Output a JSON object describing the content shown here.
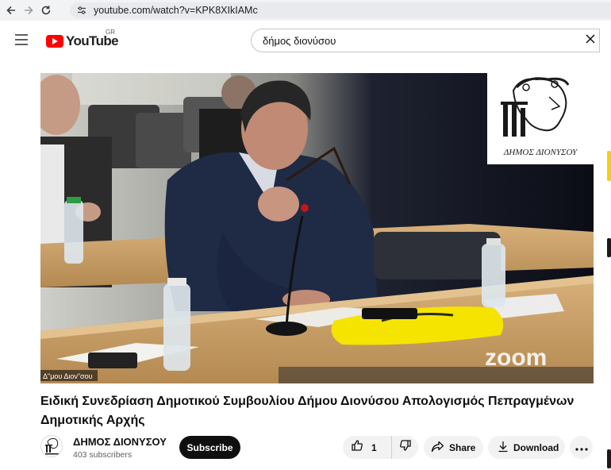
{
  "browser": {
    "url": "youtube.com/watch?v=KPK8XIkIAMc"
  },
  "header": {
    "logo_text": "YouTube",
    "country": "GR",
    "search_query": "δήμος διονύσου"
  },
  "video": {
    "logo_caption": "ΔΗΜΟΣ ΔΙΟΝΥΣΟΥ",
    "zoom_watermark": "zoom",
    "overlay_label": "Δ\"μου Διον\"σου"
  },
  "title": "Ειδική Συνεδρίαση Δημοτικού Συμβουλίου Δήμου Διονύσου Απολογισμός Πεπραγμένων Δημοτικής Αρχής",
  "channel": {
    "name": "ΔΗΜΟΣ ΔΙΟΝΥΣΟΥ",
    "subscribers": "403 subscribers",
    "subscribe_label": "Subscribe"
  },
  "actions": {
    "like_count": "1",
    "share_label": "Share",
    "download_label": "Download"
  },
  "colors": {
    "brand_red": "#ff0000",
    "subscribe_bg": "#0f0f0f",
    "pill_bg": "#f2f2f2"
  }
}
